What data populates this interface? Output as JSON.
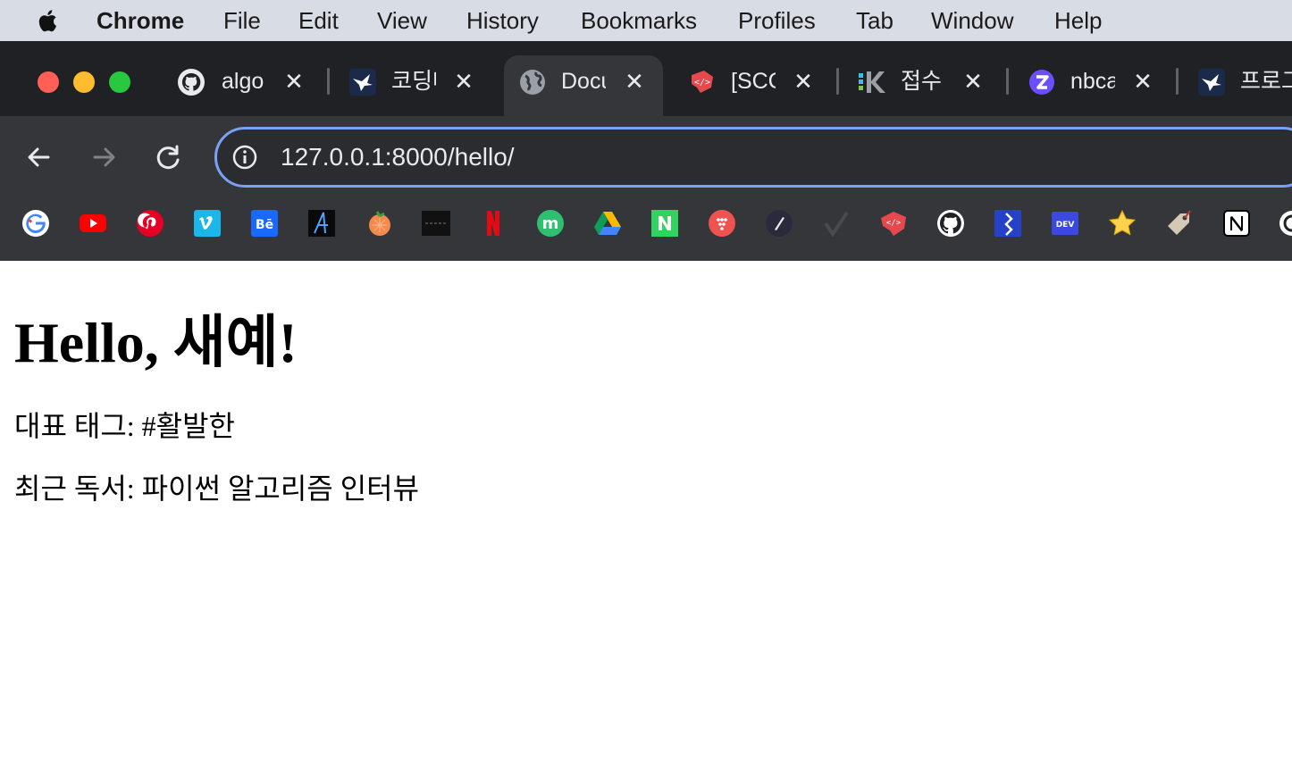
{
  "menubar": {
    "app_name": "Chrome",
    "items": [
      "File",
      "Edit",
      "View",
      "History",
      "Bookmarks",
      "Profiles",
      "Tab",
      "Window",
      "Help"
    ]
  },
  "tabs": [
    {
      "title": "algo",
      "icon": "github-icon",
      "close": "✕"
    },
    {
      "title": "코딩태",
      "icon": "bird-icon",
      "close": "✕"
    },
    {
      "title": "Docu",
      "icon": "globe-icon",
      "close": "✕",
      "active": true
    },
    {
      "title": "[SCC",
      "icon": "code-bubble-icon",
      "close": "✕"
    },
    {
      "title": "접수",
      "icon": "k-logo-icon",
      "close": "✕"
    },
    {
      "title": "nbca",
      "icon": "z-logo-icon",
      "close": "✕"
    },
    {
      "title": "프로그",
      "icon": "bird-icon",
      "close": ""
    }
  ],
  "address_bar": {
    "host": "127.0.0.1",
    "rest": ":8000/hello/"
  },
  "bookmarks": [
    "google-icon",
    "youtube-icon",
    "pinterest-icon",
    "vimeo-icon",
    "behance-icon",
    "a-script-icon",
    "tangerine-icon",
    "dark-bar-icon",
    "netflix-icon",
    "m-logo-icon",
    "google-drive-icon",
    "n-logo-icon",
    "dots-logo-icon",
    "pen-logo-icon",
    "check-icon",
    "code-bubble-icon",
    "github-icon",
    "blue-bird-icon",
    "dev-icon",
    "star-icon",
    "tag-icon",
    "notion-icon",
    "openai-icon"
  ],
  "colors": {
    "menubar_bg": "#d8dce5",
    "chrome_bg": "#202124",
    "toolbar_bg": "#35363a",
    "omnibox_border": "#7aa1f5"
  },
  "page": {
    "heading": "Hello, 새예!",
    "tag_line": "대표 태그: #활발한",
    "reading_line": "최근 독서: 파이썬 알고리즘 인터뷰"
  }
}
